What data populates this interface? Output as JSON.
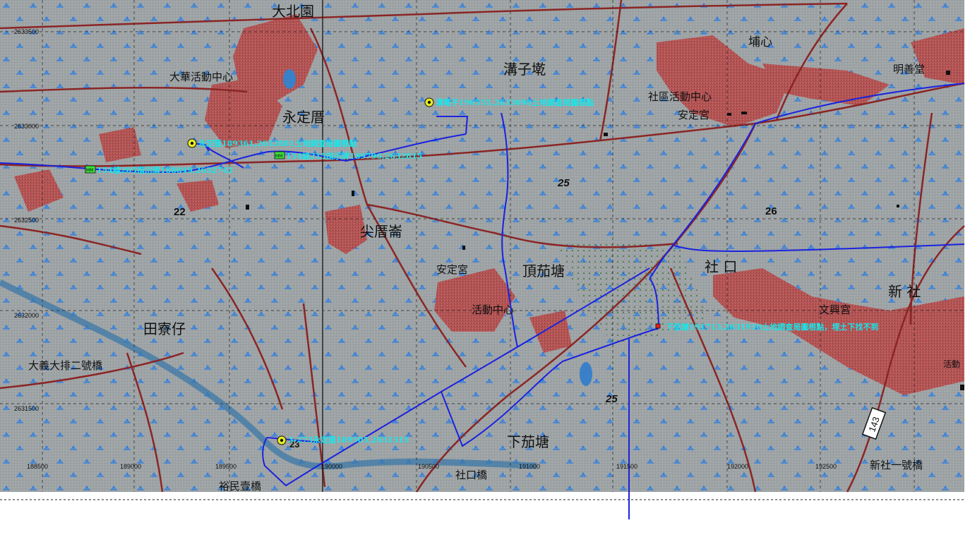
{
  "map": {
    "colors": {
      "background": "#9ea3a5",
      "paddy_symbol": "#2e7fe0",
      "road": "#8b2525",
      "settlement": "#b45050",
      "route": "#1a22e0",
      "survey_label": "#18e6ea",
      "grid": "#1d1d1d"
    },
    "place_names": [
      "大北園",
      "埔心",
      "溝子墘",
      "明善堂",
      "大華活動中心",
      "永定厝",
      "社區活動中心",
      "安定宮",
      "尖厝崙",
      "安定宮",
      "頂茄塘",
      "社 口",
      "新 社",
      "活動中心",
      "文興宮",
      "田寮仔",
      "大義大排二號橋",
      "下茄塘",
      "社口橋",
      "裕民壹橋",
      "新社一號橋",
      "活動"
    ],
    "elevations": [
      "22",
      "25",
      "26",
      "25",
      "23"
    ],
    "road_numbers": [
      "143"
    ],
    "easting_labels": [
      "188500",
      "189000",
      "189500",
      "190000",
      "190500",
      "191000",
      "191500",
      "192000",
      "192500"
    ],
    "northing_labels": [
      "2633500",
      "2633000",
      "2632500",
      "2632000",
      "2631500"
    ],
    "survey_points": [
      {
        "label": "溝墘子190555,2633098土地調查局圖根點",
        "icon": "target-icon"
      },
      {
        "label": "永定厝189361,2632881土地調查局圖根點",
        "icon": "target-icon"
      },
      {
        "label": "154線205指示牌188849,2632742",
        "icon": "sign-icon"
      },
      {
        "label": "154線215指示牌189796,2632815",
        "icon": "sign-icon"
      },
      {
        "label": "下茄塘191713,2631910土地調查局圖根點，埋土下找不到",
        "icon": "marker-icon"
      },
      {
        "label": "3-273永定厝189505,2631315",
        "icon": "target-icon"
      }
    ]
  }
}
